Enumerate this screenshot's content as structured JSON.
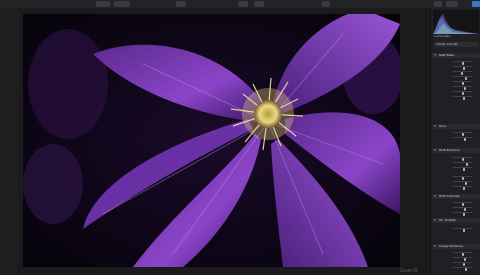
{
  "colors": {
    "accent": "#e0a83a",
    "petal": "#7a3bb0",
    "stamen": "#e6d07a",
    "panel_bg": "#202024"
  },
  "panel": {
    "histogram_label": "Luminosity",
    "preset_select": "Clarity Low NL",
    "sections": [
      {
        "label": "RAW Basic",
        "rows": 8
      },
      {
        "label": "Tone",
        "rows": 2
      },
      {
        "label": "HDR Enhance",
        "rows": 6
      },
      {
        "label": "HDR Contrast",
        "rows": 3
      },
      {
        "label": "Gt. Tonality",
        "rows": 1
      },
      {
        "label": "Image Radiance",
        "rows": 4
      }
    ]
  },
  "status": {
    "zoom": "Zoom Fit"
  }
}
